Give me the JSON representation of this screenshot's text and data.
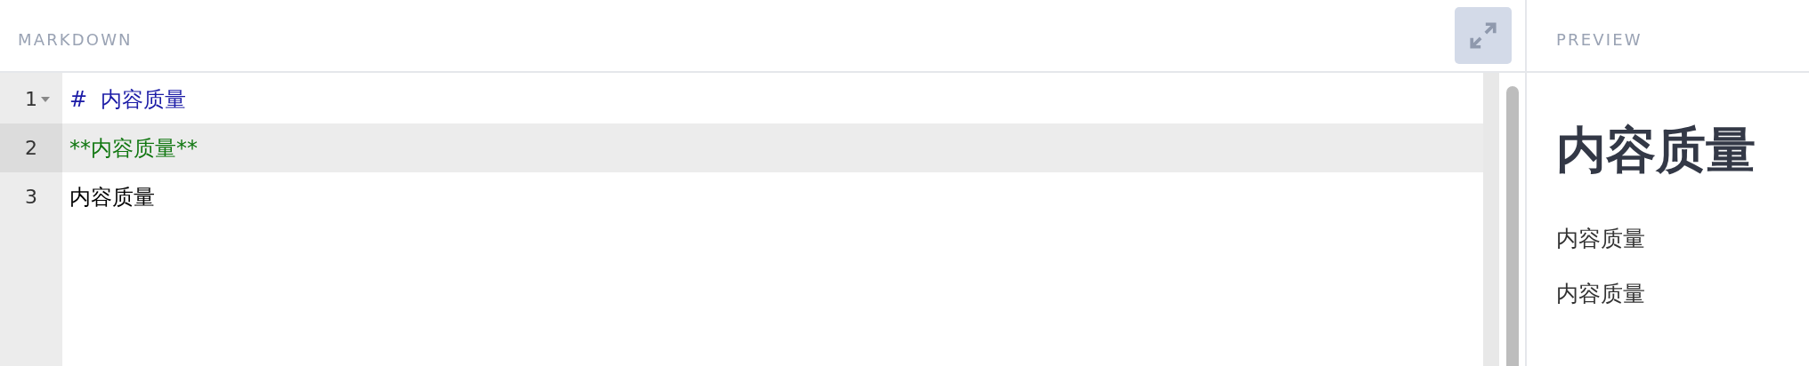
{
  "editor": {
    "title": "MARKDOWN",
    "lines": [
      {
        "number": "1",
        "text": "#  内容质量",
        "kind": "heading",
        "foldable": true,
        "selected": false
      },
      {
        "number": "2",
        "text": "**内容质量**",
        "kind": "bold",
        "foldable": false,
        "selected": true
      },
      {
        "number": "3",
        "text": "内容质量",
        "kind": "text",
        "foldable": false,
        "selected": false
      }
    ]
  },
  "preview": {
    "title": "PREVIEW",
    "blocks": [
      {
        "kind": "heading",
        "text": "内容质量"
      },
      {
        "kind": "paragraph",
        "text": "内容质量"
      },
      {
        "kind": "paragraph",
        "text": "内容质量"
      }
    ]
  }
}
